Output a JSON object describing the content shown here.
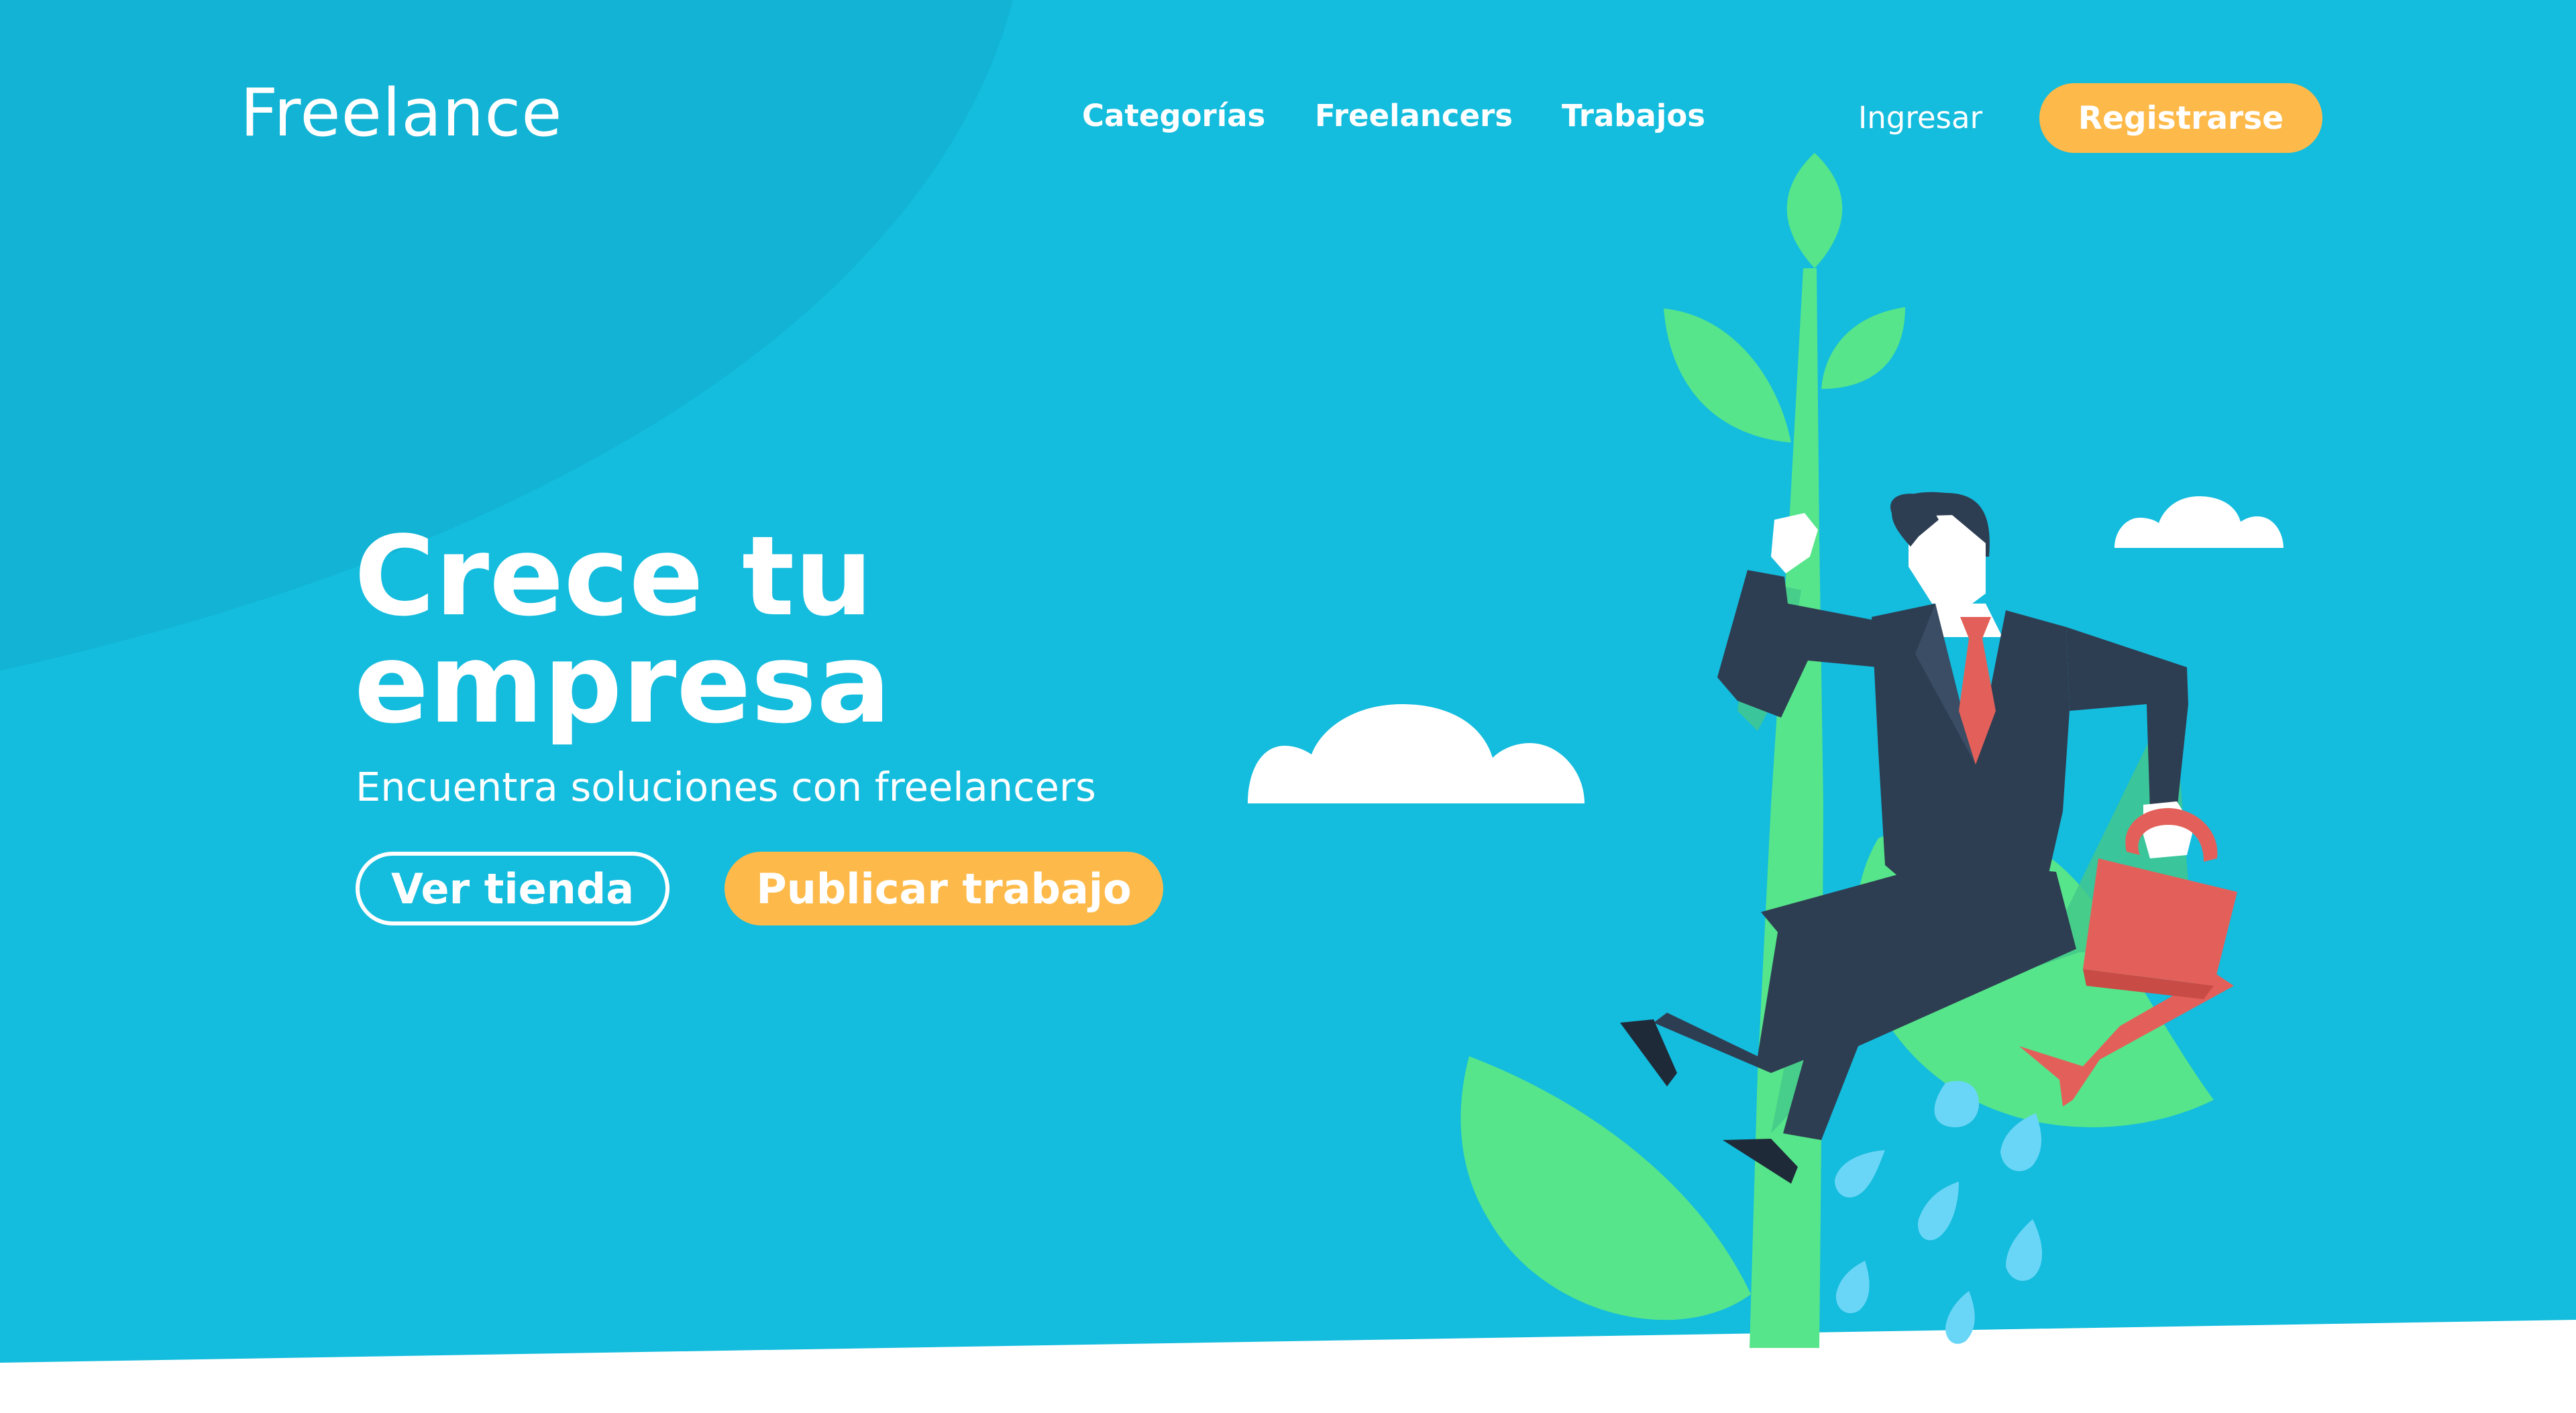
{
  "header": {
    "logo_text": "Freelance",
    "nav": {
      "categorias": "Categorías",
      "freelancers": "Freelancers",
      "trabajos": "Trabajos"
    },
    "login_label": "Ingresar",
    "register_label": "Registrarse"
  },
  "hero": {
    "title_line1": "Crece  tu",
    "title_line2": "empresa",
    "subtitle": "Encuentra soluciones con freelancers",
    "secondary_cta": "Ver tienda",
    "primary_cta": "Publicar trabajo"
  },
  "illustration": {
    "subject": "businessman-climbing-beanstalk",
    "elements": [
      "beanstalk",
      "leaves",
      "clouds",
      "watering-can",
      "water-drops"
    ]
  },
  "colors": {
    "background": "#14bcdd",
    "background_shape": "#12b2d3",
    "accent": "#fdba4a",
    "leaf": "#56e58b",
    "suit": "#2e3e52",
    "tie_and_can": "#e3605a",
    "text": "#ffffff"
  }
}
